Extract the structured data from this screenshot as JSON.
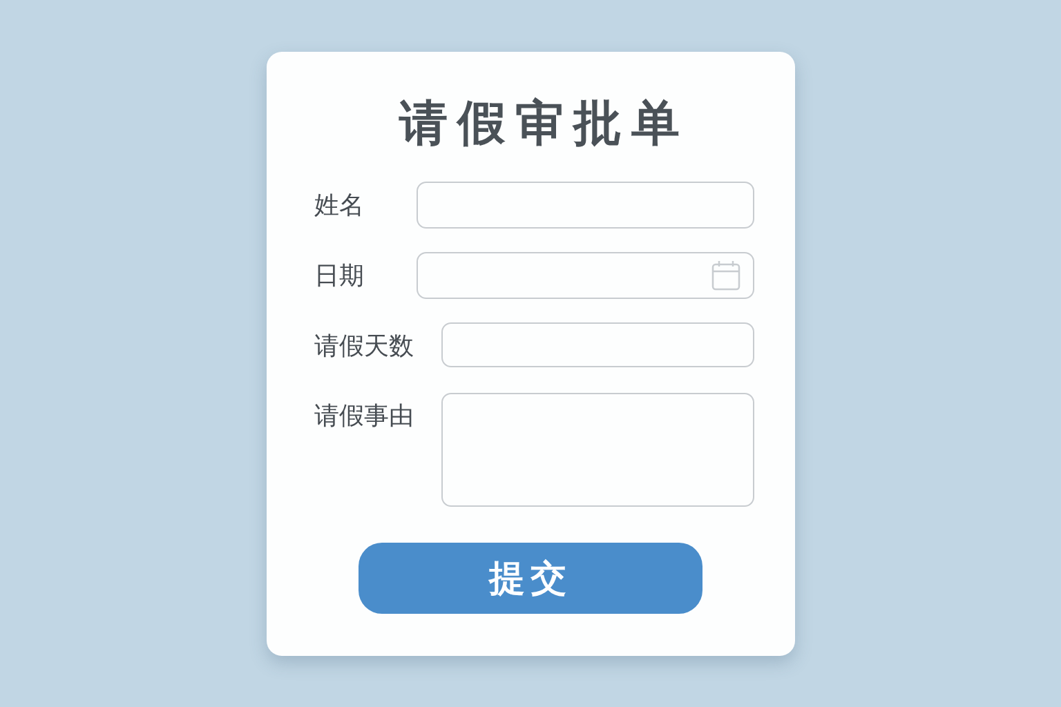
{
  "form": {
    "title": "请假审批单",
    "fields": [
      {
        "label": "姓名",
        "kind": "text"
      },
      {
        "label": "日期",
        "kind": "date"
      },
      {
        "label": "请假天数",
        "kind": "text"
      },
      {
        "label": "请假事由",
        "kind": "textarea"
      }
    ],
    "submit": "提交"
  }
}
